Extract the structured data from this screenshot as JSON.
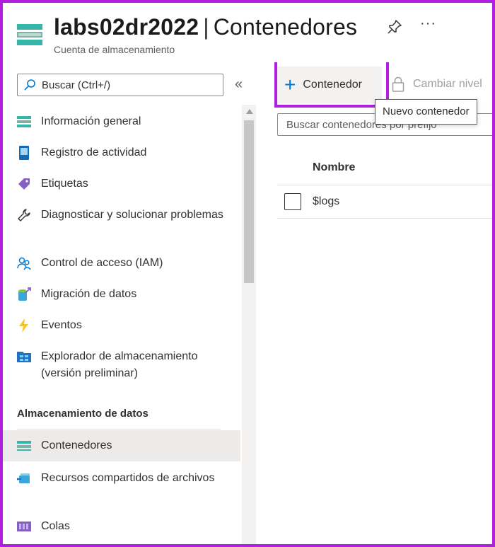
{
  "header": {
    "resource_name": "labs02dr2022",
    "separator": "|",
    "section": "Contenedores",
    "subtitle": "Cuenta de almacenamiento",
    "more_label": "···"
  },
  "sidebar": {
    "search_placeholder": "Buscar (Ctrl+/)",
    "collapse_label": "«",
    "items": [
      {
        "label": "Información general",
        "icon": "storage-overview-icon"
      },
      {
        "label": "Registro de actividad",
        "icon": "activity-log-icon"
      },
      {
        "label": "Etiquetas",
        "icon": "tag-icon"
      },
      {
        "label": "Diagnosticar y solucionar problemas",
        "icon": "wrench-icon"
      },
      {
        "label": "Control de acceso (IAM)",
        "icon": "users-icon"
      },
      {
        "label": "Migración de datos",
        "icon": "data-migration-icon"
      },
      {
        "label": "Eventos",
        "icon": "lightning-icon"
      },
      {
        "label": "Explorador de almacenamiento (versión preliminar)",
        "icon": "storage-explorer-icon"
      }
    ],
    "section_title": "Almacenamiento de datos",
    "section_items": [
      {
        "label": "Contenedores",
        "icon": "containers-icon",
        "active": true
      },
      {
        "label": "Recursos compartidos de archivos",
        "icon": "file-shares-icon"
      },
      {
        "label": "Colas",
        "icon": "queues-icon"
      }
    ]
  },
  "toolbar": {
    "add_container_label": "Contenedor",
    "change_tier_label": "Cambiar nivel",
    "tooltip": "Nuevo contenedor"
  },
  "main": {
    "filter_placeholder": "Buscar contenedores por prefijo",
    "columns": [
      "Nombre"
    ],
    "rows": [
      {
        "name": "$logs"
      }
    ]
  },
  "colors": {
    "accent": "#0078d4",
    "highlight": "#b11ee0",
    "active_bg": "#edebe9"
  }
}
